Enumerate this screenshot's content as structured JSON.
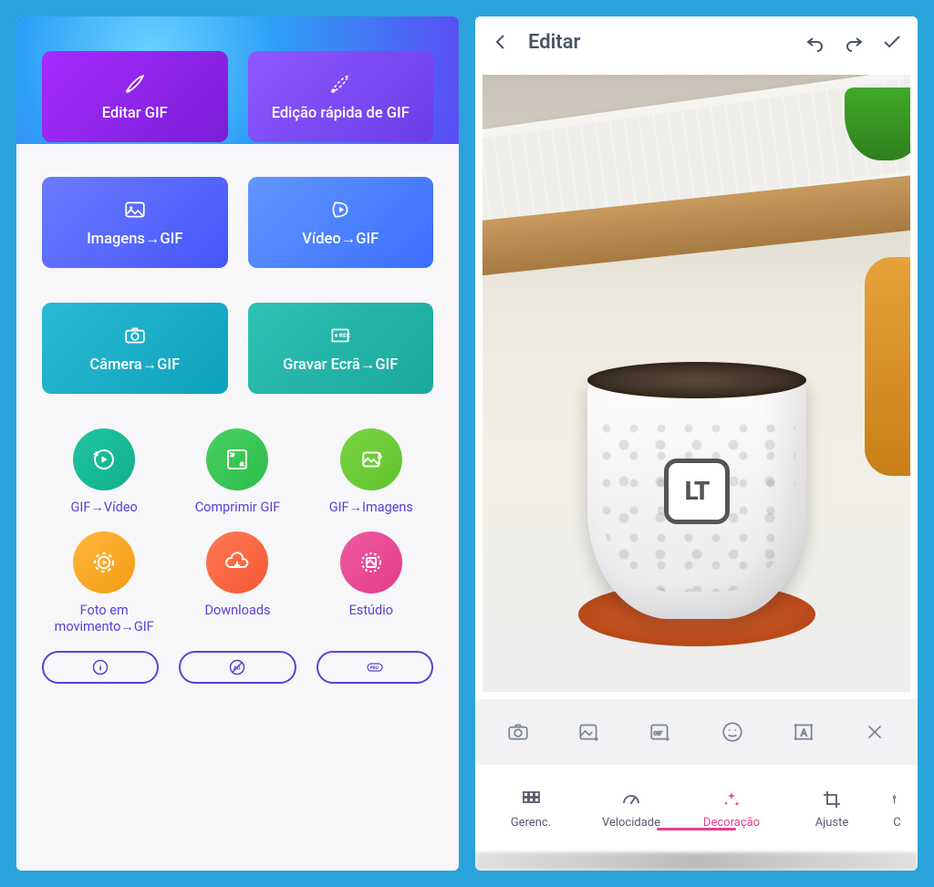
{
  "left": {
    "tiles": [
      {
        "label": "Editar GIF"
      },
      {
        "label": "Edição rápida de GIF"
      },
      {
        "label": "Imagens→GIF"
      },
      {
        "label": "Vídeo→GIF"
      },
      {
        "label": "Câmera→GIF"
      },
      {
        "label": "Gravar Ecrã→GIF"
      }
    ],
    "circles": [
      {
        "label": "GIF→Vídeo"
      },
      {
        "label": "Comprimir GIF"
      },
      {
        "label": "GIF→Imagens"
      },
      {
        "label": "Foto em movimento→GIF"
      },
      {
        "label": "Downloads"
      },
      {
        "label": "Estúdio"
      }
    ],
    "pills": [
      {
        "name": "info"
      },
      {
        "name": "ad"
      },
      {
        "name": "pro",
        "text": "PRO"
      }
    ]
  },
  "right": {
    "title": "Editar",
    "tabs": [
      {
        "label": "Gerenc."
      },
      {
        "label": "Velocidade"
      },
      {
        "label": "Decoração"
      },
      {
        "label": "Ajuste"
      },
      {
        "label": "C"
      }
    ],
    "active_tab_index": 2
  }
}
